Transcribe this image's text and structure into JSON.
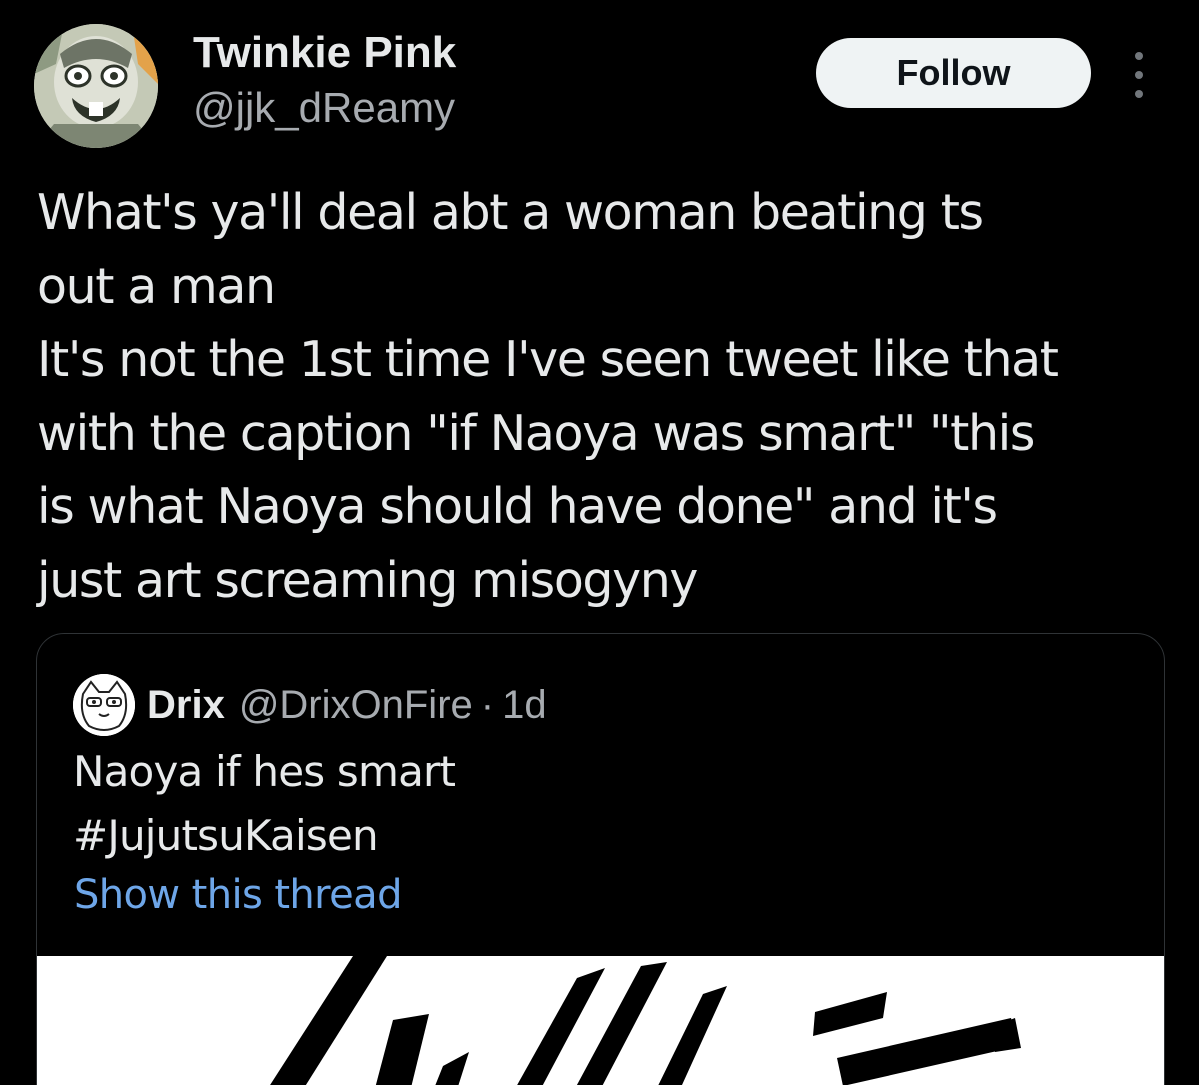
{
  "tweet": {
    "author": {
      "display_name": "Twinkie Pink",
      "handle": "@jjk_dReamy"
    },
    "follow_label": "Follow",
    "text_lines": [
      "What's ya'll deal abt a woman beating ts",
      "out a man",
      "It's not the 1st time I've seen tweet like that",
      "with the caption \"if Naoya was smart\"  \"this",
      "is what Naoya should have done\"  and it's",
      "just art screaming misogyny"
    ]
  },
  "quoted": {
    "name": "Drix",
    "handle": "@DrixOnFire",
    "separator": "·",
    "time": "1d",
    "text_lines": [
      "Naoya if hes smart",
      "#JujutsuKaisen"
    ],
    "show_thread": "Show this thread"
  },
  "colors": {
    "background": "#000000",
    "text": "#e7e9ea",
    "secondary_text": "#a7abb0",
    "link": "#6ea6e8",
    "follow_button_bg": "#eff3f4",
    "border": "#2f3336"
  },
  "icons": {
    "more": "more-vertical-icon"
  }
}
